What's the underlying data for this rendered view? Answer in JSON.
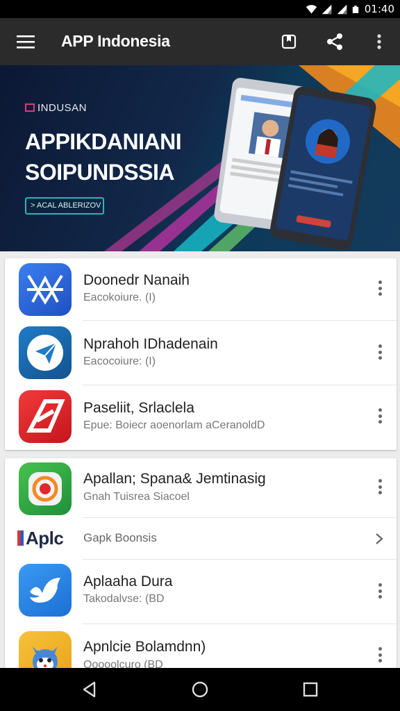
{
  "status_bar": {
    "time": "01:40",
    "icons": [
      "wifi-icon",
      "signal-icon",
      "signal-icon",
      "battery-icon"
    ]
  },
  "app_bar": {
    "title": "APP Indonesia",
    "icons": [
      "menu-icon",
      "bookmark-icon",
      "share-icon",
      "more-vert-icon"
    ]
  },
  "banner": {
    "kicker": "INDUSAN",
    "title_line1": "APPIKDANIANI",
    "title_line2": "SOIPUNDSSIA",
    "button_label": "> ACAL ABLERIZOV"
  },
  "list_card_1": [
    {
      "name": "Doonedr Nanaih",
      "subtitle": "Eacokoiure. (I)",
      "icon": "blue-star-app-icon"
    },
    {
      "name": "Nprahoh IDhadenain",
      "subtitle": "Eacocoiure: (I)",
      "icon": "send-plane-app-icon"
    },
    {
      "name": "Paseliit, Srlaclela",
      "subtitle": "Epue: Boiecr aoenorlam aCeranoldD",
      "icon": "red-a-app-icon"
    }
  ],
  "list_card_2": {
    "top_item": {
      "name": "Apallan; Spana& Jemtinasig",
      "subtitle": "Gnah Tuisrea Siacoel",
      "icon": "green-camera-app-icon"
    },
    "section": {
      "logo": "Aplc",
      "label": "Gapk Boonsis"
    },
    "items": [
      {
        "name": "Aplaaha Dura",
        "subtitle": "Takodalvse: (BD",
        "icon": "blue-bird-app-icon"
      },
      {
        "name": "Apnlcie Bolamdnn)",
        "subtitle": "Qoooolcuro (BD",
        "icon": "cat-mascot-app-icon"
      }
    ]
  },
  "nav_bar": {
    "icons": [
      "back-icon",
      "home-icon",
      "recents-icon"
    ]
  },
  "colors": {
    "app_bar": "#2b2b2b",
    "accent_blue": "#2f6fe0",
    "accent_red": "#e0282e",
    "accent_green": "#3cb44a",
    "banner_bg": "#0c1834"
  }
}
